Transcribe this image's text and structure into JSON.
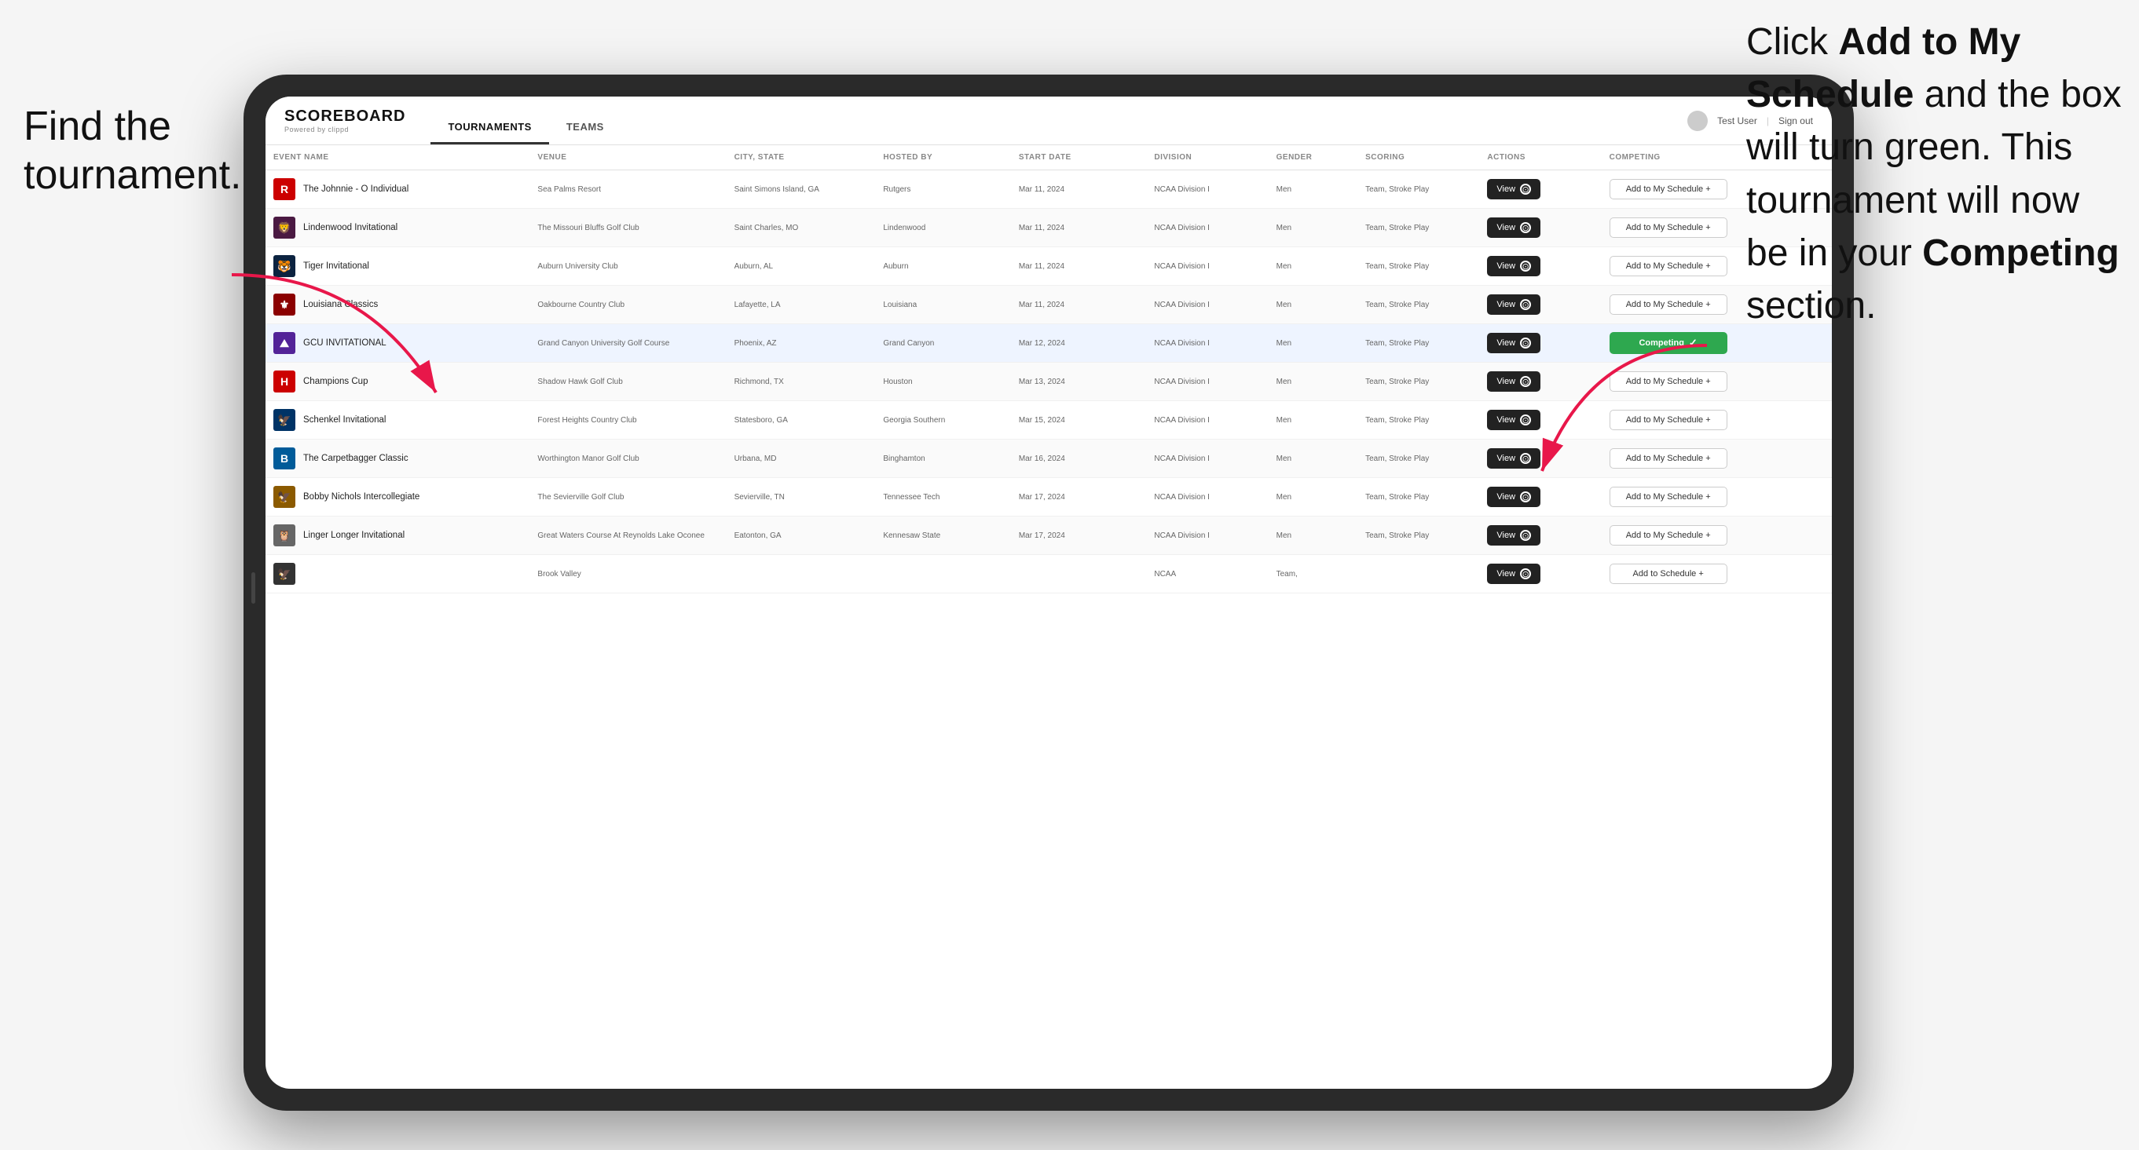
{
  "page": {
    "background": "#f5f5f5"
  },
  "annotations": {
    "left": "Find the\ntournament.",
    "right_line1": "Click ",
    "right_bold1": "Add to My\nSchedule",
    "right_line2": " and the\nbox will turn green.\nThis tournament\nwill now be in\nyour ",
    "right_bold2": "Competing",
    "right_line3": "\nsection."
  },
  "header": {
    "logo": "SCOREBOARD",
    "logo_sub": "Powered by clippd",
    "nav_tabs": [
      "TOURNAMENTS",
      "TEAMS"
    ],
    "active_tab": "TOURNAMENTS",
    "user": "Test User",
    "signout": "Sign out"
  },
  "table": {
    "columns": [
      "EVENT NAME",
      "VENUE",
      "CITY, STATE",
      "HOSTED BY",
      "START DATE",
      "DIVISION",
      "GENDER",
      "SCORING",
      "ACTIONS",
      "COMPETING"
    ],
    "rows": [
      {
        "id": 1,
        "logo_color": "#cc0000",
        "logo_text": "R",
        "event_name": "The Johnnie - O Individual",
        "venue": "Sea Palms Resort",
        "city_state": "Saint Simons Island, GA",
        "hosted_by": "Rutgers",
        "start_date": "Mar 11, 2024",
        "division": "NCAA Division I",
        "gender": "Men",
        "scoring": "Team, Stroke Play",
        "action": "View",
        "competing": "Add to My Schedule +",
        "is_competing": false,
        "highlighted": false
      },
      {
        "id": 2,
        "logo_color": "#4a1942",
        "logo_text": "🦁",
        "event_name": "Lindenwood Invitational",
        "venue": "The Missouri Bluffs Golf Club",
        "city_state": "Saint Charles, MO",
        "hosted_by": "Lindenwood",
        "start_date": "Mar 11, 2024",
        "division": "NCAA Division I",
        "gender": "Men",
        "scoring": "Team, Stroke Play",
        "action": "View",
        "competing": "Add to My Schedule +",
        "is_competing": false,
        "highlighted": false
      },
      {
        "id": 3,
        "logo_color": "#0c2340",
        "logo_text": "🐯",
        "event_name": "Tiger Invitational",
        "venue": "Auburn University Club",
        "city_state": "Auburn, AL",
        "hosted_by": "Auburn",
        "start_date": "Mar 11, 2024",
        "division": "NCAA Division I",
        "gender": "Men",
        "scoring": "Team, Stroke Play",
        "action": "View",
        "competing": "Add to My Schedule +",
        "is_competing": false,
        "highlighted": false
      },
      {
        "id": 4,
        "logo_color": "#8b0000",
        "logo_text": "⚜",
        "event_name": "Louisiana Classics",
        "venue": "Oakbourne Country Club",
        "city_state": "Lafayette, LA",
        "hosted_by": "Louisiana",
        "start_date": "Mar 11, 2024",
        "division": "NCAA Division I",
        "gender": "Men",
        "scoring": "Team, Stroke Play",
        "action": "View",
        "competing": "Add to My Schedule +",
        "is_competing": false,
        "highlighted": false
      },
      {
        "id": 5,
        "logo_color": "#522398",
        "logo_text": "⛰",
        "event_name": "GCU INVITATIONAL",
        "venue": "Grand Canyon University Golf Course",
        "city_state": "Phoenix, AZ",
        "hosted_by": "Grand Canyon",
        "start_date": "Mar 12, 2024",
        "division": "NCAA Division I",
        "gender": "Men",
        "scoring": "Team, Stroke Play",
        "action": "View",
        "competing": "Competing",
        "is_competing": true,
        "highlighted": true
      },
      {
        "id": 6,
        "logo_color": "#cc0000",
        "logo_text": "H",
        "event_name": "Champions Cup",
        "venue": "Shadow Hawk Golf Club",
        "city_state": "Richmond, TX",
        "hosted_by": "Houston",
        "start_date": "Mar 13, 2024",
        "division": "NCAA Division I",
        "gender": "Men",
        "scoring": "Team, Stroke Play",
        "action": "View",
        "competing": "Add to My Schedule +",
        "is_competing": false,
        "highlighted": false
      },
      {
        "id": 7,
        "logo_color": "#003366",
        "logo_text": "🦅",
        "event_name": "Schenkel Invitational",
        "venue": "Forest Heights Country Club",
        "city_state": "Statesboro, GA",
        "hosted_by": "Georgia Southern",
        "start_date": "Mar 15, 2024",
        "division": "NCAA Division I",
        "gender": "Men",
        "scoring": "Team, Stroke Play",
        "action": "View",
        "competing": "Add to My Schedule +",
        "is_competing": false,
        "highlighted": false
      },
      {
        "id": 8,
        "logo_color": "#005b99",
        "logo_text": "B",
        "event_name": "The Carpetbagger Classic",
        "venue": "Worthington Manor Golf Club",
        "city_state": "Urbana, MD",
        "hosted_by": "Binghamton",
        "start_date": "Mar 16, 2024",
        "division": "NCAA Division I",
        "gender": "Men",
        "scoring": "Team, Stroke Play",
        "action": "View",
        "competing": "Add to My Schedule +",
        "is_competing": false,
        "highlighted": false
      },
      {
        "id": 9,
        "logo_color": "#8b5a00",
        "logo_text": "🦅",
        "event_name": "Bobby Nichols Intercollegiate",
        "venue": "The Sevierville Golf Club",
        "city_state": "Sevierville, TN",
        "hosted_by": "Tennessee Tech",
        "start_date": "Mar 17, 2024",
        "division": "NCAA Division I",
        "gender": "Men",
        "scoring": "Team, Stroke Play",
        "action": "View",
        "competing": "Add to My Schedule +",
        "is_competing": false,
        "highlighted": false
      },
      {
        "id": 10,
        "logo_color": "#ffcc00",
        "logo_text": "🦉",
        "event_name": "Linger Longer Invitational",
        "venue": "Great Waters Course At Reynolds Lake Oconee",
        "city_state": "Eatonton, GA",
        "hosted_by": "Kennesaw State",
        "start_date": "Mar 17, 2024",
        "division": "NCAA Division I",
        "gender": "Men",
        "scoring": "Team, Stroke Play",
        "action": "View",
        "competing": "Add to My Schedule +",
        "is_competing": false,
        "highlighted": false
      },
      {
        "id": 11,
        "logo_color": "#333",
        "logo_text": "🦅",
        "event_name": "",
        "venue": "Brook Valley",
        "city_state": "",
        "hosted_by": "",
        "start_date": "",
        "division": "NCAA",
        "gender": "Team,",
        "scoring": "",
        "action": "View",
        "competing": "Add to Schedule +",
        "is_competing": false,
        "highlighted": false
      }
    ]
  },
  "buttons": {
    "view_label": "View",
    "add_schedule_label": "Add to My Schedule +",
    "competing_label": "Competing",
    "add_schedule_alt": "Add to Schedule +"
  },
  "arrow_colors": {
    "left_arrow": "#e8174a",
    "right_arrow": "#e8174a"
  }
}
